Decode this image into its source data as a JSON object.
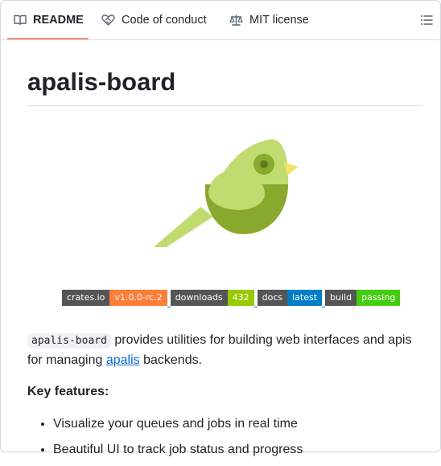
{
  "tabs": [
    {
      "label": "README",
      "icon": "book-icon"
    },
    {
      "label": "Code of conduct",
      "icon": "heart-handshake-icon"
    },
    {
      "label": "MIT license",
      "icon": "scale-icon"
    }
  ],
  "outline_icon": "list-unordered-icon",
  "readme": {
    "title": "apalis-board",
    "badges": [
      {
        "label": "crates.io",
        "value": "v1.0.0-rc.2",
        "color": "#fe7d37"
      },
      {
        "label": "downloads",
        "value": "432",
        "color": "#97ca00"
      },
      {
        "label": "docs",
        "value": "latest",
        "color": "#007ec6"
      },
      {
        "label": "build",
        "value": "passing",
        "color": "#4c1"
      }
    ],
    "intro_code": "apalis-board",
    "intro_text_1": " provides utilities for building web interfaces and apis for managing ",
    "intro_link": "apalis",
    "intro_text_2": " backends.",
    "key_features_heading": "Key features:",
    "features": [
      "Visualize your queues and jobs in real time",
      "Beautiful UI to track job status and progress"
    ]
  },
  "colors": {
    "tab_underline": "#fd8c73",
    "link": "#0969da",
    "bird_light": "#c0dc70",
    "bird_dark": "#89a92e",
    "bird_beak": "#f4e36a"
  }
}
